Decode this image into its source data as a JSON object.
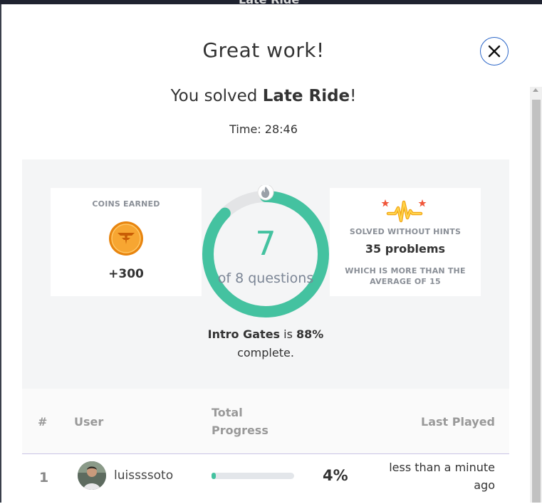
{
  "background": {
    "ghost_title": "Late Ride"
  },
  "modal": {
    "title": "Great work!",
    "close_icon": "close-icon",
    "solved_prefix": "You solved ",
    "solved_name": "Late Ride",
    "solved_suffix": "!",
    "time": "Time: 28:46"
  },
  "stats": {
    "coins": {
      "label": "COINS EARNED",
      "icon": "coin-icon",
      "value": "+300"
    },
    "questions": {
      "icon": "flame-icon",
      "completed": "7",
      "total_label": "of 8 questions",
      "progress_fraction": 0.875,
      "color": "#44c2a0"
    },
    "hints": {
      "icon": "sparkle-chart-icon",
      "label": "SOLVED WITHOUT HINTS",
      "value": "35 problems",
      "sub": "WHICH IS MORE THAN THE AVERAGE OF 15"
    },
    "course": {
      "name": "Intro Gates",
      "middle": " is ",
      "percent": "88%",
      "end": "complete."
    }
  },
  "leaderboard": {
    "headers": {
      "rank": "#",
      "user": "User",
      "progress": "Total Progress",
      "last_played": "Last Played"
    },
    "rows": [
      {
        "rank": "1",
        "avatar": "avatar",
        "user": "luissssoto",
        "progress_fraction": 0.04,
        "percent": "4%",
        "last_played": "less than a minute ago"
      }
    ]
  }
}
